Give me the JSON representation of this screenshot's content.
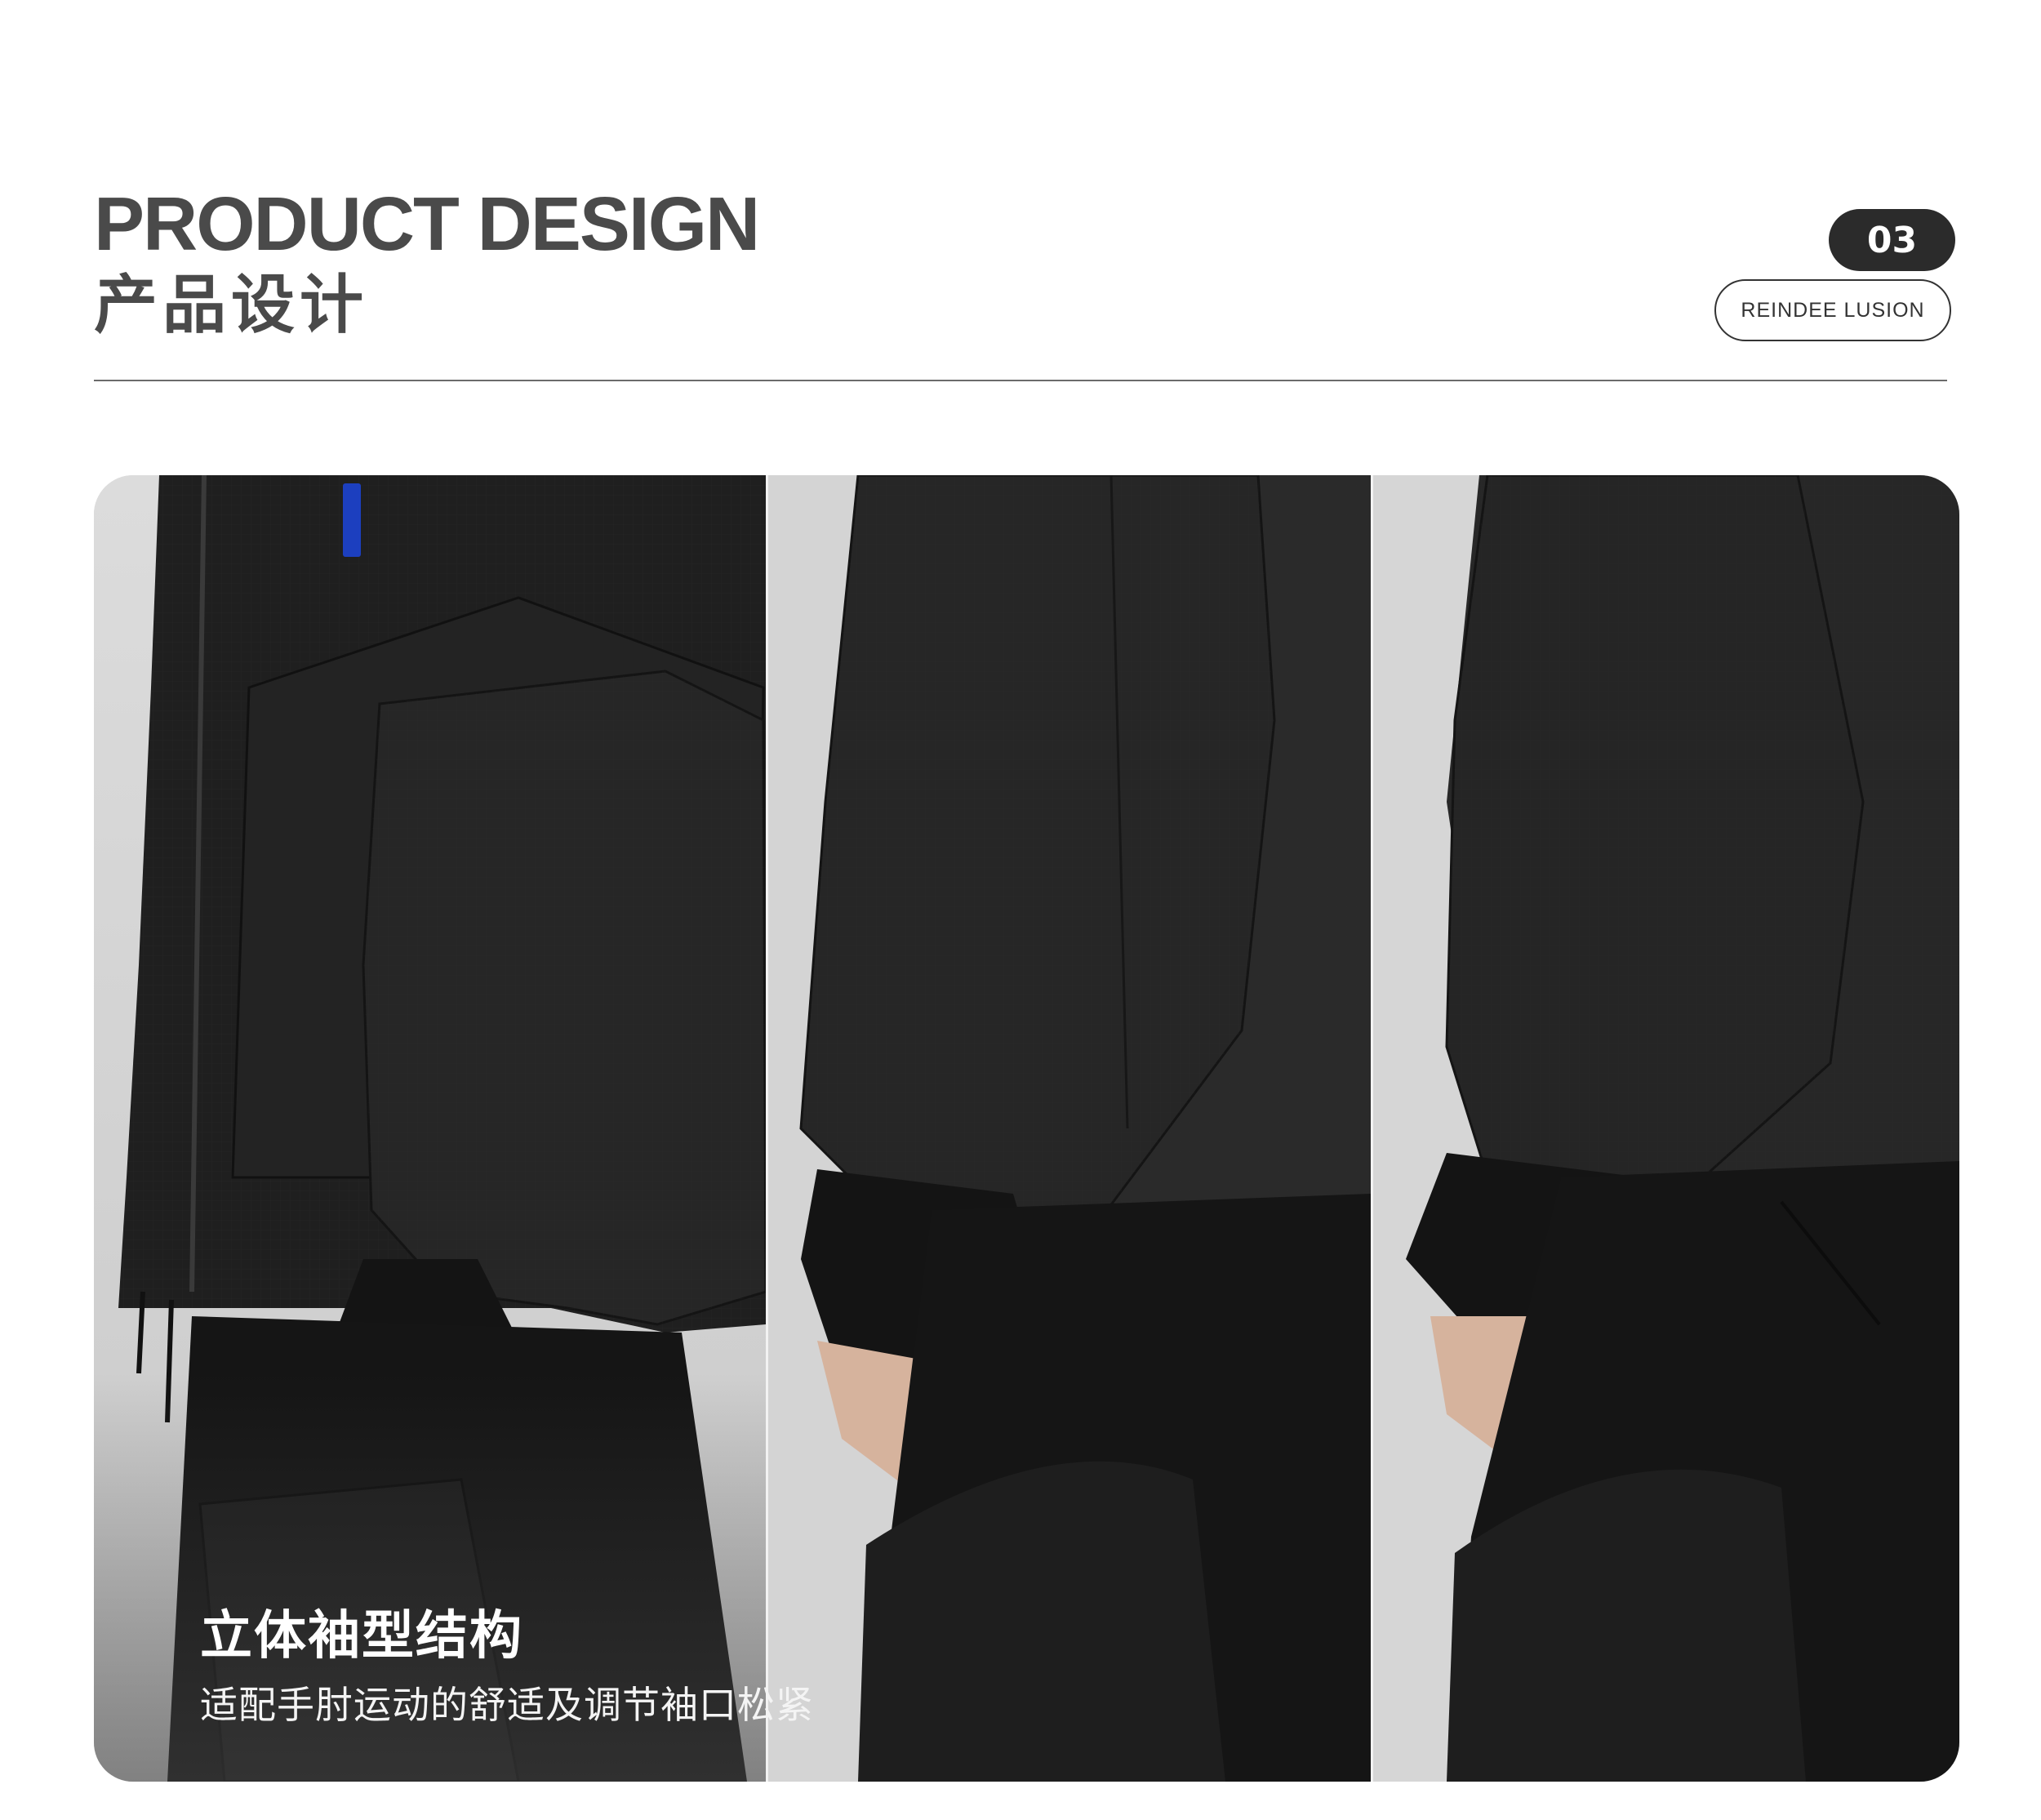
{
  "header": {
    "title_en": "PRODUCT DESIGN",
    "title_cn": "产品设计",
    "page_number": "03",
    "brand": "REINDEE LUSION"
  },
  "feature": {
    "title": "立体袖型结构",
    "description": "适配手肘运动的舒适及调节袖口松紧"
  },
  "colors": {
    "heading": "#4a4a4a",
    "badge_bg": "#2b2b2b",
    "garment": "#1e1e1e",
    "backdrop": "#d9d9d9"
  },
  "photos": [
    "jacket-sleeve-side-view-photo",
    "jacket-sleeve-back-view-photo",
    "jacket-sleeve-cuff-view-photo"
  ]
}
